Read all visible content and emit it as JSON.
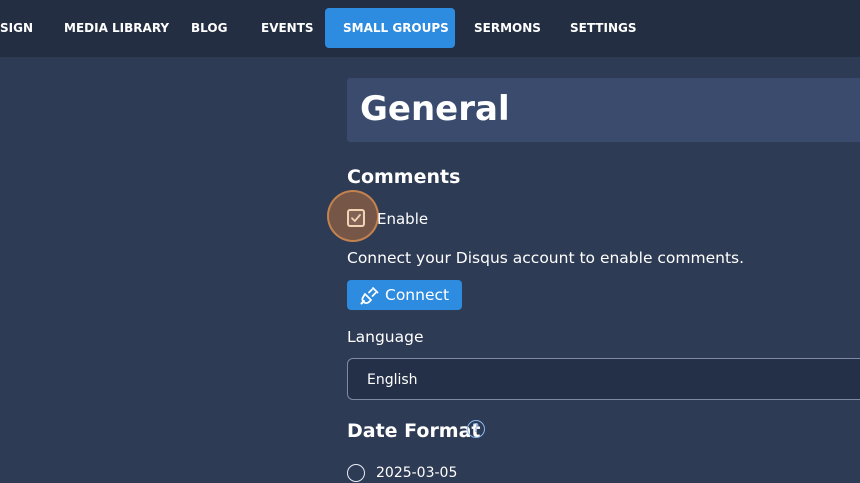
{
  "nav": {
    "items": [
      {
        "label": "SIGN",
        "active": false
      },
      {
        "label": "MEDIA LIBRARY",
        "active": false
      },
      {
        "label": "BLOG",
        "active": false
      },
      {
        "label": "EVENTS",
        "active": false
      },
      {
        "label": "SMALL GROUPS",
        "active": true
      },
      {
        "label": "SERMONS",
        "active": false
      },
      {
        "label": "SETTINGS",
        "active": false
      }
    ]
  },
  "page": {
    "title": "General"
  },
  "comments": {
    "heading": "Comments",
    "enable_label": "Enable",
    "enabled": true,
    "description": "Connect your Disqus account to enable comments.",
    "connect_label": "Connect"
  },
  "language": {
    "label": "Language",
    "value": "English"
  },
  "date_format": {
    "heading": "Date Format",
    "help_glyph": "?",
    "options": [
      {
        "label": "2025-03-05",
        "selected": false
      }
    ]
  },
  "colors": {
    "background": "#2e3b55",
    "topnav": "#232e42",
    "accent": "#2d8be0",
    "title_box": "#3a4b6e",
    "highlight": "#b26e3c"
  },
  "icons": {
    "checkbox": "check-icon",
    "connect": "plug-icon",
    "help": "question-circle-icon",
    "radio": "radio-icon"
  }
}
